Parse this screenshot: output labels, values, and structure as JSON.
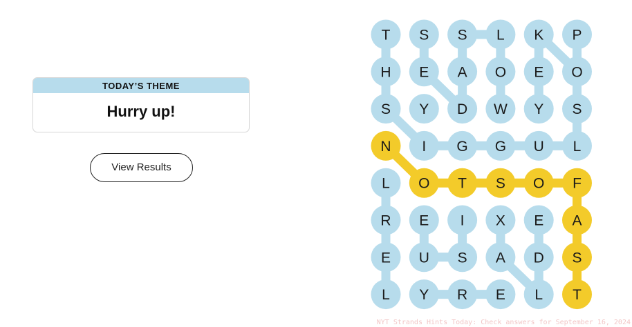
{
  "theme": {
    "header": "TODAY’S THEME",
    "title": "Hurry up!"
  },
  "buttons": {
    "view_results": "View Results"
  },
  "colors": {
    "found": "#f3cb2a",
    "unfound": "#b7dcec"
  },
  "grid": {
    "rows": [
      [
        "T",
        "S",
        "S",
        "L",
        "K",
        "P"
      ],
      [
        "H",
        "E",
        "A",
        "O",
        "E",
        "O"
      ],
      [
        "S",
        "Y",
        "D",
        "W",
        "Y",
        "S"
      ],
      [
        "N",
        "I",
        "G",
        "G",
        "U",
        "L"
      ],
      [
        "L",
        "O",
        "T",
        "S",
        "O",
        "F"
      ],
      [
        "R",
        "E",
        "I",
        "X",
        "E",
        "A"
      ],
      [
        "E",
        "U",
        "S",
        "A",
        "D",
        "S"
      ],
      [
        "L",
        "Y",
        "R",
        "E",
        "L",
        "T"
      ]
    ],
    "found_cells": [
      [
        3,
        0
      ],
      [
        4,
        1
      ],
      [
        4,
        2
      ],
      [
        4,
        3
      ],
      [
        4,
        4
      ],
      [
        4,
        5
      ],
      [
        5,
        5
      ],
      [
        6,
        5
      ],
      [
        7,
        5
      ]
    ],
    "connections": [
      {
        "path": [
          [
            3,
            0
          ],
          [
            4,
            1
          ],
          [
            4,
            2
          ],
          [
            4,
            3
          ],
          [
            4,
            4
          ],
          [
            4,
            5
          ]
        ],
        "color": "found"
      },
      {
        "path": [
          [
            4,
            5
          ],
          [
            5,
            5
          ],
          [
            6,
            5
          ],
          [
            7,
            5
          ]
        ],
        "color": "found"
      },
      {
        "path": [
          [
            0,
            0
          ],
          [
            1,
            0
          ],
          [
            2,
            0
          ],
          [
            3,
            1
          ],
          [
            3,
            2
          ],
          [
            3,
            3
          ],
          [
            3,
            4
          ],
          [
            3,
            5
          ],
          [
            2,
            5
          ],
          [
            1,
            5
          ],
          [
            0,
            4
          ]
        ],
        "color": "unfound"
      },
      {
        "path": [
          [
            0,
            1
          ],
          [
            1,
            1
          ],
          [
            2,
            2
          ],
          [
            1,
            2
          ],
          [
            0,
            2
          ],
          [
            0,
            3
          ],
          [
            1,
            3
          ],
          [
            2,
            3
          ]
        ],
        "color": "unfound"
      },
      {
        "path": [
          [
            0,
            4
          ],
          [
            1,
            4
          ],
          [
            2,
            4
          ]
        ],
        "color": "unfound"
      },
      {
        "path": [
          [
            0,
            5
          ],
          [
            1,
            5
          ]
        ],
        "color": "unfound"
      },
      {
        "path": [
          [
            4,
            0
          ],
          [
            5,
            0
          ],
          [
            6,
            0
          ],
          [
            7,
            0
          ]
        ],
        "color": "unfound"
      },
      {
        "path": [
          [
            5,
            1
          ],
          [
            6,
            1
          ],
          [
            6,
            2
          ],
          [
            5,
            2
          ]
        ],
        "color": "unfound"
      },
      {
        "path": [
          [
            7,
            1
          ],
          [
            7,
            2
          ],
          [
            7,
            3
          ]
        ],
        "color": "unfound"
      },
      {
        "path": [
          [
            5,
            3
          ],
          [
            6,
            3
          ],
          [
            7,
            4
          ],
          [
            6,
            4
          ],
          [
            5,
            4
          ]
        ],
        "color": "unfound"
      }
    ]
  },
  "watermark": "NYT Strands Hints Today: Check answers for September 16, 2024"
}
